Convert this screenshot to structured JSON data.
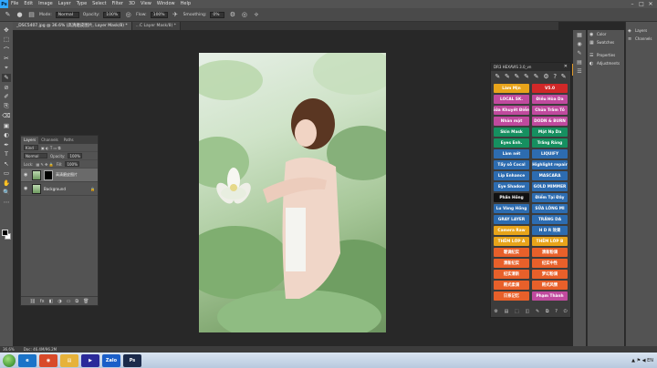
{
  "app": {
    "logo": "Ps"
  },
  "menu": [
    "File",
    "Edit",
    "Image",
    "Layer",
    "Type",
    "Select",
    "Filter",
    "3D",
    "View",
    "Window",
    "Help"
  ],
  "window_controls": [
    "–",
    "□",
    "✕"
  ],
  "options_bar": {
    "mode_label": "Mode:",
    "mode_value": "Normal",
    "opacity_label": "Opacity:",
    "opacity_value": "100%",
    "flow_label": "Flow:",
    "flow_value": "100%",
    "smoothing_label": "Smoothing:",
    "smoothing_value": "0%"
  },
  "tabs": [
    {
      "label": "_DSC5407.jpg @ 36.6% (高清磨皮图片, Layer Mask/8) *",
      "active": true
    },
    {
      "label": "...C Layer Mask/8) *",
      "active": false
    }
  ],
  "tools": [
    "✥",
    "⬚",
    "⌒",
    "✂",
    "⌖",
    "✎",
    "⊘",
    "✐",
    "⎘",
    "⌫",
    "▣",
    "◐",
    "✒",
    "T",
    "↖",
    "▭",
    "✋",
    "🔍",
    "⋯"
  ],
  "layers_panel": {
    "tabs": [
      "Layers",
      "Channels",
      "Paths"
    ],
    "kind_label": "Kind",
    "blend_mode": "Normal",
    "opacity_label": "Opacity:",
    "opacity_value": "100%",
    "lock_label": "Lock:",
    "fill_label": "Fill:",
    "fill_value": "100%",
    "layers": [
      {
        "name": "高清磨皮图片",
        "selected": true,
        "has_mask": true
      },
      {
        "name": "Background",
        "selected": false,
        "has_mask": false
      }
    ],
    "footer_icons": [
      "⛓",
      "fx",
      "◧",
      "◑",
      "▭",
      "⧉",
      "🗑"
    ]
  },
  "plugin_panel": {
    "title": "DR3 HEXAVIS 3.0_vn",
    "close": "✕",
    "icons": [
      "✎",
      "✎",
      "✎",
      "✎",
      "✎",
      "⚙",
      "?",
      "✎"
    ],
    "buttons": [
      {
        "label": "Làm Mịn",
        "color": "#e8a41a"
      },
      {
        "label": "V5.0",
        "color": "#d12828"
      },
      {
        "label": "LOCAL SK.",
        "color": "#c04a9e"
      },
      {
        "label": "Điều Hòa Da",
        "color": "#c04a9e"
      },
      {
        "label": "Sửa Khuyết Điểm",
        "color": "#c04a9e"
      },
      {
        "label": "Chữa Trắm Tô",
        "color": "#c04a9e"
      },
      {
        "label": "Nhăn mặt",
        "color": "#c04a9e"
      },
      {
        "label": "DODN & BURN",
        "color": "#c04a9e"
      },
      {
        "label": "Skin Mask",
        "color": "#169060"
      },
      {
        "label": "Mặt Nạ Da",
        "color": "#169060"
      },
      {
        "label": "Eyes Enh.",
        "color": "#169060"
      },
      {
        "label": "Trắng Răng",
        "color": "#169060"
      },
      {
        "label": "Làm nét",
        "color": "#2d6cb0"
      },
      {
        "label": "LIQUIFY",
        "color": "#2d6cb0"
      },
      {
        "label": "Tẩy sỗ Cocal",
        "color": "#2d6cb0"
      },
      {
        "label": "Highlight repair",
        "color": "#2d6cb0"
      },
      {
        "label": "Lip Enhance",
        "color": "#2d6cb0"
      },
      {
        "label": "MASCARA",
        "color": "#2d6cb0"
      },
      {
        "label": "Eye Shadow",
        "color": "#2d6cb0"
      },
      {
        "label": "GOLD MIMMER",
        "color": "#2d6cb0"
      },
      {
        "label": "Phấn Hồng",
        "color": "#111111"
      },
      {
        "label": "Điểm Tại Đây",
        "color": "#2d6cb0"
      },
      {
        "label": "Lu Vàng Hồng",
        "color": "#2d6cb0"
      },
      {
        "label": "SỬA LÔNG MI",
        "color": "#2d6cb0"
      },
      {
        "label": "GRAY LAYER",
        "color": "#2d6cb0"
      },
      {
        "label": "TRẮNG DA",
        "color": "#2d6cb0"
      },
      {
        "label": "Camera Raw",
        "color": "#e8a41a"
      },
      {
        "label": "H D R 效果",
        "color": "#2d6cb0"
      },
      {
        "label": "THÊM LỚP A",
        "color": "#e8a41a"
      },
      {
        "label": "THÊM LỚP B",
        "color": "#e8a41a"
      },
      {
        "label": "暖调纪实",
        "color": "#e8602a"
      },
      {
        "label": "清新粉调",
        "color": "#e8602a"
      },
      {
        "label": "清新纪实",
        "color": "#e8602a"
      },
      {
        "label": "纪实中性",
        "color": "#e8602a"
      },
      {
        "label": "纪实清新",
        "color": "#e8602a"
      },
      {
        "label": "梦幻粉调",
        "color": "#e8602a"
      },
      {
        "label": "韩式柔调",
        "color": "#e8602a"
      },
      {
        "label": "韩式风情",
        "color": "#e8602a"
      },
      {
        "label": "日系记忆",
        "color": "#e8602a"
      },
      {
        "label": "Phạm Thành",
        "color": "#c04a9e"
      }
    ],
    "footer_icons": [
      "⚙",
      "▤",
      "⬚",
      "◫",
      "✎",
      "⧉",
      "?",
      "⏻"
    ]
  },
  "right_panels": {
    "strip_icons": [
      "▦",
      "◉",
      "✎",
      "▤",
      "☰"
    ],
    "group1": [
      {
        "icon": "◉",
        "label": "Color"
      },
      {
        "icon": "▦",
        "label": "Swatches"
      }
    ],
    "group2": [
      {
        "icon": "☰",
        "label": "Properties"
      },
      {
        "icon": "◐",
        "label": "Adjustments"
      }
    ],
    "group3": [
      {
        "icon": "◈",
        "label": "Layers"
      },
      {
        "icon": "≡",
        "label": "Channels"
      }
    ]
  },
  "status_bar": {
    "zoom": "36.6%",
    "doc": "Doc: 46.4M/96.2M"
  },
  "taskbar": {
    "apps": [
      {
        "label": "e",
        "color": "#1a73c8"
      },
      {
        "label": "◉",
        "color": "#d84a2a"
      },
      {
        "label": "▤",
        "color": "#e6b23a"
      },
      {
        "label": "▶",
        "color": "#2a2a9a"
      },
      {
        "label": "Zalo",
        "color": "#1a5ec8"
      },
      {
        "label": "Ps",
        "color": "#1b2a4a"
      }
    ],
    "tray": "▲ ⚑ ◀ EN"
  }
}
